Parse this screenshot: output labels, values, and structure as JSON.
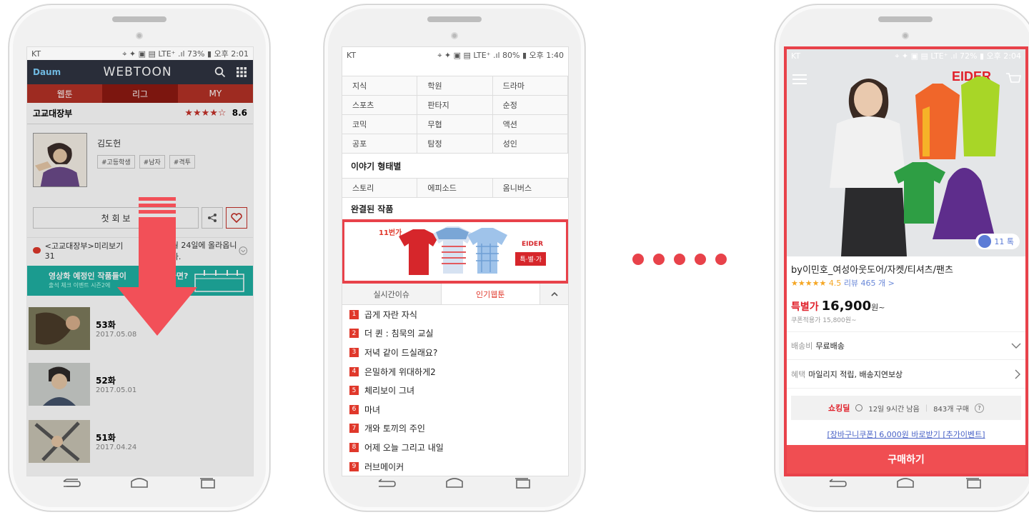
{
  "phones": {
    "webtoon": {
      "status": {
        "carrier": "KT",
        "right": "⌖ ✦ ▣ ▤ LTE⁺ .ıl 73% ▮ 오후 2:01"
      },
      "brand": "Daum",
      "title": "WEBTOON",
      "tabs": [
        "웹툰",
        "리그",
        "MY"
      ],
      "work_title": "고교대장부",
      "stars": "★★★★☆",
      "rating": "8.6",
      "author": "김도헌",
      "tags": [
        "#고등학생",
        "#남자",
        "#격투"
      ],
      "first_view": "첫 회 보",
      "notice": "<고교대장부>미리보기 31",
      "notice_tail": "월 24일에 올라옵니다.",
      "banner_main": "영상화 예정인 작품들이",
      "banner_tail": "라면?",
      "banner_sub": "출석 체크 이벤트 시즌2에",
      "episodes": [
        {
          "title": "53화",
          "date": "2017.05.08"
        },
        {
          "title": "52화",
          "date": "2017.05.01"
        },
        {
          "title": "51화",
          "date": "2017.04.24"
        }
      ]
    },
    "list": {
      "status": {
        "carrier": "KT",
        "right": "⌖ ✦ ▣ ▤ LTE⁺ .ıl 80% ▮ 오후 1:40"
      },
      "genres": [
        "지식",
        "학원",
        "드라마",
        "스포츠",
        "판타지",
        "순정",
        "코믹",
        "무협",
        "액션",
        "공포",
        "탐정",
        "성인"
      ],
      "story_title": "이야기 형태별",
      "story_types": [
        "스토리",
        "에피소드",
        "옴니버스"
      ],
      "completed_title": "완결된 작품",
      "ad": {
        "tag": "11번가",
        "brand": "EIDER",
        "badge": "특·별·가"
      },
      "tabs": [
        "실시간이슈",
        "인기웹툰"
      ],
      "ranking": [
        "곱게 자란 자식",
        "더 퀸 : 침묵의 교실",
        "저녁 같이 드실래요?",
        "은밀하게 위대하게2",
        "체리보이 그녀",
        "마녀",
        "개와 토끼의 주인",
        "어제 오늘 그리고 내일",
        "러브메이커"
      ]
    },
    "shop": {
      "status": {
        "carrier": "KT",
        "right": "⌖ ✦ ▣ ▤ LTE⁺ .ıl 72% ▮ 오후 2:04"
      },
      "brand": "EIDER",
      "talk_count": "11 톡",
      "product_title": "by이민호_여성아웃도어/자켓/티셔츠/팬츠",
      "stars": "★★★★★",
      "rating": "4.5",
      "reviews": "리뷰 465 개 >",
      "price_label": "특별가",
      "price": "16,900",
      "price_unit": "원~",
      "coupon_price": "쿠폰적용가 15,800원~",
      "shipping_label": "배송비",
      "shipping_value": "무료배송",
      "benefit_label": "혜택",
      "benefit_value": "마일리지 적립, 배송지연보상",
      "shocking_brand": "쇼킹딜",
      "time_left": "12일 9시간 남음",
      "purchase_count": "843개 구매",
      "coupon_link": "[장바구니쿠폰] 6,000원 바로받기 [추가이벤트]",
      "buy_button": "구매하기"
    }
  },
  "colors": {
    "accent": "#e8424a",
    "webtoon_red": "#b43226",
    "teal": "#1fb1a3"
  }
}
